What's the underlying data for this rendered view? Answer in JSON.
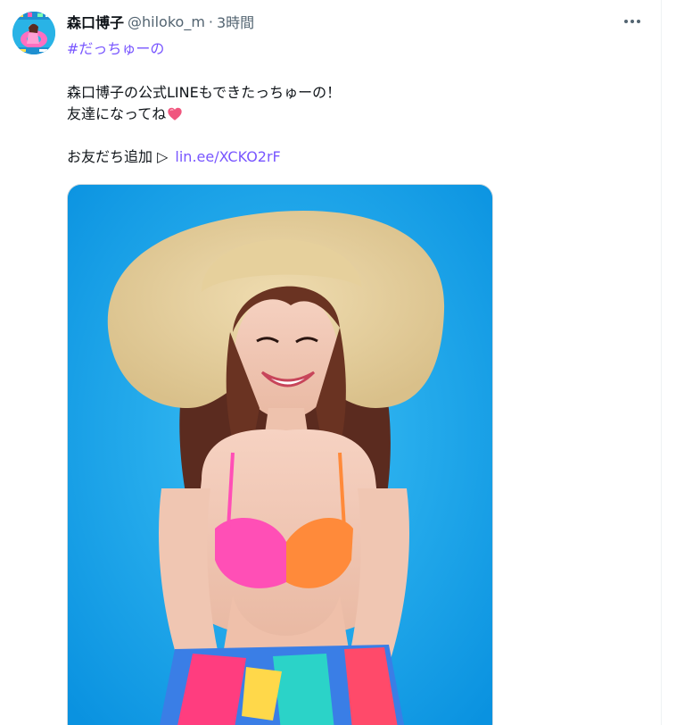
{
  "tweet": {
    "display_name": "森口博子",
    "handle": "@hiloko_m",
    "separator": "·",
    "timestamp": "3時間",
    "hashtag": "#だっちゅーの",
    "text_line1": "森口博子の公式LINEもできたっちゅーの！",
    "text_line2": "友達になってね",
    "text_line3_prefix": "お友だち追加 ▷",
    "link_text": "lin.ee/XCKO2rF"
  },
  "icons": {
    "avatar": "avatar-image",
    "more": "more-dots-icon",
    "heart": "pink-heart-emoji"
  },
  "colors": {
    "link": "#7856ff",
    "name": "#0f1419",
    "secondary": "#536471",
    "photo_background": "#1ea8ef"
  }
}
